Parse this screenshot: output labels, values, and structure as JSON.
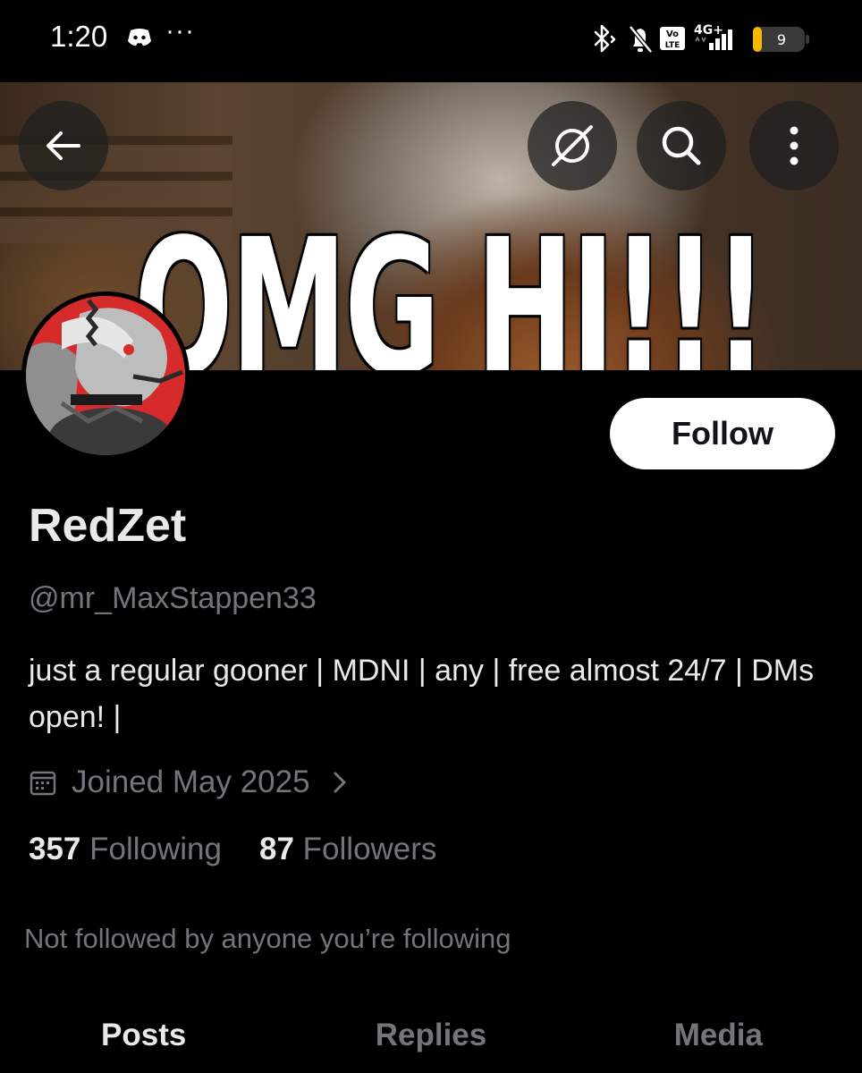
{
  "status_bar": {
    "time": "1:20",
    "more_indicator": "···",
    "network_label": "4G+",
    "volte_label": "Vo LTE",
    "battery_level": "9",
    "icons": [
      "discord-icon",
      "bluetooth-icon",
      "muted-bell-icon",
      "volte-icon",
      "signal-icon",
      "battery-icon"
    ]
  },
  "banner": {
    "text": "OMG HI!!!"
  },
  "nav": {
    "icons": [
      "back-arrow-icon",
      "grok-icon",
      "search-icon",
      "more-vertical-icon"
    ]
  },
  "profile": {
    "display_name": "RedZet",
    "handle": "@mr_MaxStappen33",
    "bio": "just a regular gooner | MDNI | any | free almost 24/7 | DMs open! |",
    "joined": "Joined May 2025",
    "following_count": "357",
    "following_label": "Following",
    "followers_count": "87",
    "followers_label": "Followers",
    "mutuals_note": "Not followed by anyone you’re following"
  },
  "actions": {
    "follow_label": "Follow"
  },
  "tabs": [
    {
      "label": "Posts",
      "active": true
    },
    {
      "label": "Replies",
      "active": false
    },
    {
      "label": "Media",
      "active": false
    }
  ],
  "colors": {
    "background": "#000000",
    "primary_text": "#e7e9ea",
    "secondary_text": "#71767b",
    "follow_button_bg": "#ffffff",
    "avatar_accent": "#d62b2b"
  }
}
